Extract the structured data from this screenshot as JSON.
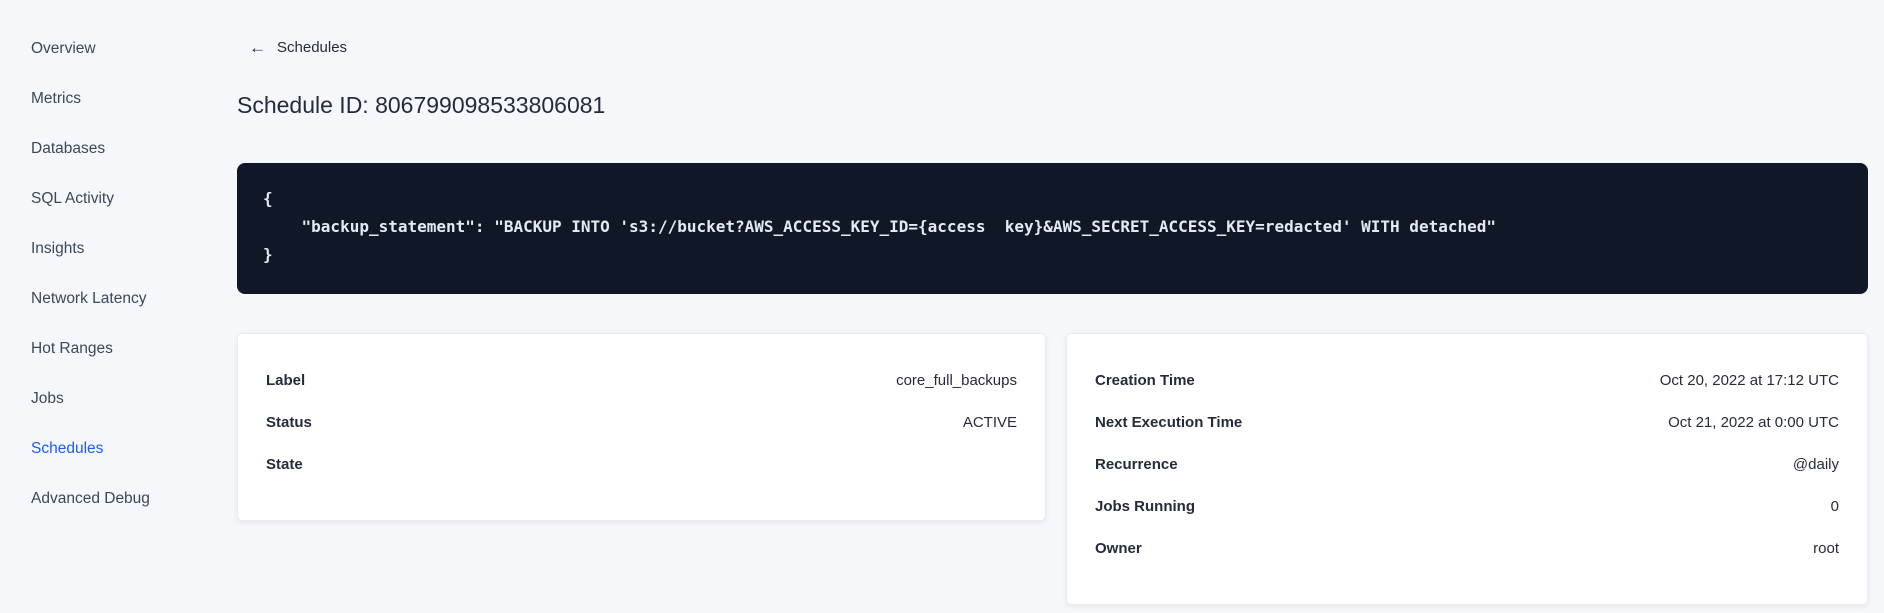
{
  "sidebar": {
    "items": [
      {
        "label": "Overview",
        "active": false
      },
      {
        "label": "Metrics",
        "active": false
      },
      {
        "label": "Databases",
        "active": false
      },
      {
        "label": "SQL Activity",
        "active": false
      },
      {
        "label": "Insights",
        "active": false
      },
      {
        "label": "Network Latency",
        "active": false
      },
      {
        "label": "Hot Ranges",
        "active": false
      },
      {
        "label": "Jobs",
        "active": false
      },
      {
        "label": "Schedules",
        "active": true
      },
      {
        "label": "Advanced Debug",
        "active": false
      }
    ]
  },
  "header": {
    "back_label": "Schedules",
    "back_icon": "←",
    "title": "Schedule ID: 806799098533806081"
  },
  "code_block": {
    "lines": [
      "{",
      "    \"backup_statement\": \"BACKUP INTO 's3://bucket?AWS_ACCESS_KEY_ID={access  key}&AWS_SECRET_ACCESS_KEY=redacted' WITH detached\"",
      "}"
    ]
  },
  "details_card": {
    "rows": [
      {
        "label": "Label",
        "value": "core_full_backups"
      },
      {
        "label": "Status",
        "value": "ACTIVE"
      },
      {
        "label": "State",
        "value": ""
      }
    ]
  },
  "schedule_card": {
    "rows": [
      {
        "label": "Creation Time",
        "value": "Oct 20, 2022 at 17:12 UTC"
      },
      {
        "label": "Next Execution Time",
        "value": "Oct 21, 2022 at 0:00 UTC"
      },
      {
        "label": "Recurrence",
        "value": "@daily"
      },
      {
        "label": "Jobs Running",
        "value": "0"
      },
      {
        "label": "Owner",
        "value": "root"
      }
    ]
  },
  "colors": {
    "accent_blue": "#1a5cf5",
    "code_background": "#101828",
    "page_background": "#f5f7fa"
  }
}
